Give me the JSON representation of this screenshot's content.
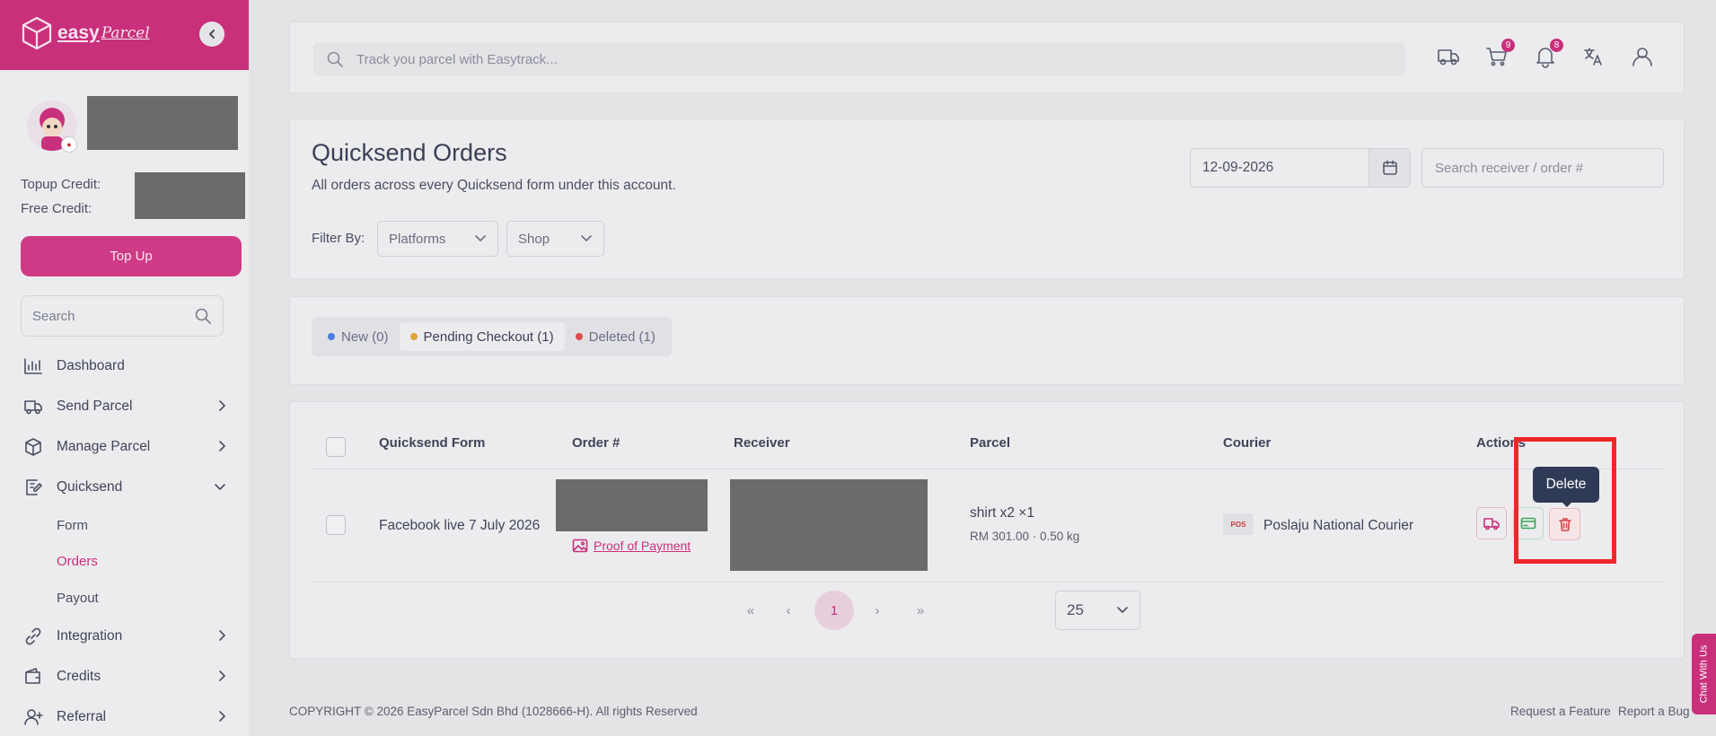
{
  "brand": {
    "easy": "easy",
    "parcel": "Parcel"
  },
  "sidebar": {
    "topup_credit_label": "Topup Credit:",
    "free_credit_label": "Free Credit:",
    "topup_button": "Top Up",
    "search_placeholder": "Search",
    "nav": [
      {
        "label": "Dashboard",
        "icon": "chart-bar-icon"
      },
      {
        "label": "Send Parcel",
        "icon": "truck-icon"
      },
      {
        "label": "Manage Parcel",
        "icon": "box-icon"
      },
      {
        "label": "Quicksend",
        "icon": "edit-note-icon"
      },
      {
        "label": "Integration",
        "icon": "link-icon"
      },
      {
        "label": "Credits",
        "icon": "wallet-icon"
      },
      {
        "label": "Referral",
        "icon": "user-plus-icon"
      }
    ],
    "quicksend_sub": [
      {
        "label": "Form"
      },
      {
        "label": "Orders"
      },
      {
        "label": "Payout"
      }
    ]
  },
  "topbar": {
    "search_placeholder": "Track you parcel with Easytrack...",
    "cart_count": "9",
    "notification_count": "8"
  },
  "header": {
    "title": "Quicksend Orders",
    "subtitle": "All orders across every Quicksend form under this account.",
    "filter_label": "Filter By:",
    "platforms": "Platforms",
    "shop": "Shop",
    "date": "12-09-2026",
    "receiver_search_placeholder": "Search receiver / order #"
  },
  "tabs": [
    {
      "label": "New (0)",
      "color": "#4a7fe0"
    },
    {
      "label": "Pending Checkout (1)",
      "color": "#e0a43a"
    },
    {
      "label": "Deleted (1)",
      "color": "#e04a4a"
    }
  ],
  "table": {
    "headers": [
      "Quicksend Form",
      "Order #",
      "Receiver",
      "Parcel",
      "Courier",
      "Actions"
    ],
    "row": {
      "form": "Facebook live 7 July 2026",
      "proof_link": "Proof of Payment",
      "parcel_items": "shirt x2  ×1",
      "parcel_meta": "RM 301.00 · 0.50 kg",
      "courier": "Poslaju National Courier",
      "courier_logo_text": "POS"
    }
  },
  "pagination": {
    "first": "«",
    "prev": "‹",
    "current": "1",
    "next": "›",
    "last": "»",
    "per_page": "25"
  },
  "tooltip": "Delete",
  "footer": {
    "copyright": "COPYRIGHT © 2026 EasyParcel Sdn Bhd (1028666-H). All rights Reserved",
    "request_feature": "Request a Feature",
    "report_bug": "Report a Bug"
  },
  "chat_tab": "Chat With Us",
  "colors": {
    "brand": "#c9307c",
    "highlight": "#f0262a",
    "tooltip_bg": "#2f3a56"
  }
}
